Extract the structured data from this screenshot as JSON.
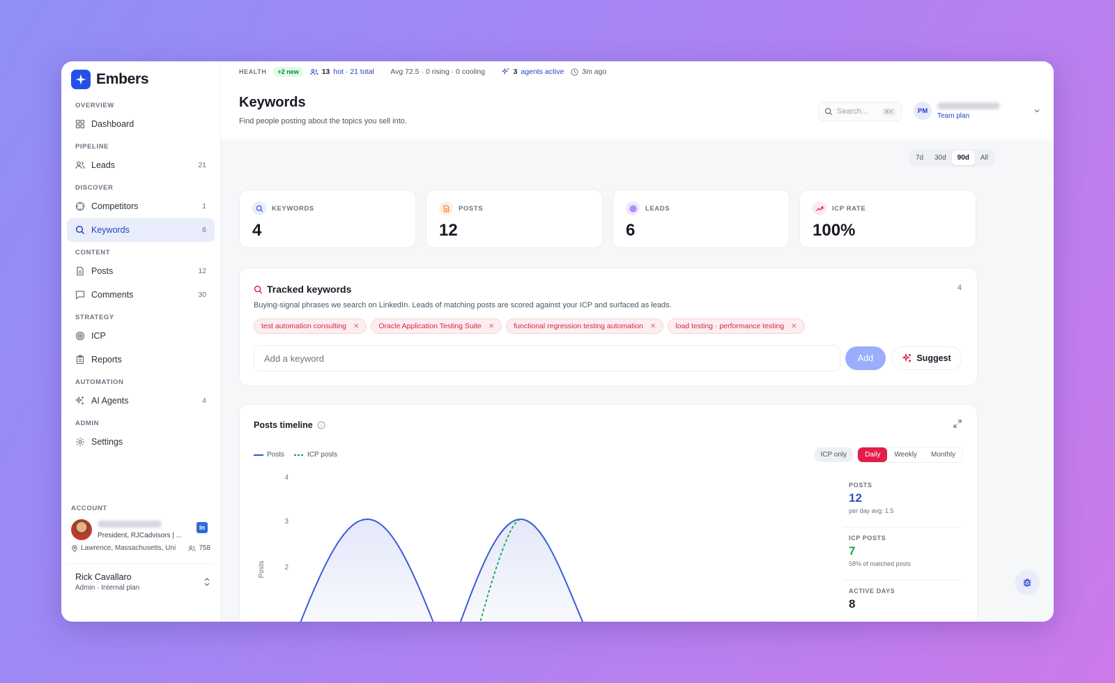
{
  "brand": {
    "name": "Embers"
  },
  "sidebar": {
    "sections": {
      "overview": "OVERVIEW",
      "pipeline": "PIPELINE",
      "discover": "DISCOVER",
      "content": "CONTENT",
      "strategy": "STRATEGY",
      "automation": "AUTOMATION",
      "admin": "ADMIN"
    },
    "items": {
      "dashboard": {
        "label": "Dashboard",
        "icon": "grid-icon"
      },
      "leads": {
        "label": "Leads",
        "count": "21",
        "icon": "users-icon"
      },
      "competitors": {
        "label": "Competitors",
        "count": "1",
        "icon": "crosshair-icon"
      },
      "keywords": {
        "label": "Keywords",
        "count": "6",
        "icon": "search-icon"
      },
      "posts": {
        "label": "Posts",
        "count": "12",
        "icon": "file-icon"
      },
      "comments": {
        "label": "Comments",
        "count": "30",
        "icon": "comment-icon"
      },
      "icp": {
        "label": "ICP",
        "icon": "target-icon"
      },
      "reports": {
        "label": "Reports",
        "icon": "clipboard-icon"
      },
      "agents": {
        "label": "AI Agents",
        "count": "4",
        "icon": "sparkles-icon"
      },
      "settings": {
        "label": "Settings",
        "icon": "gear-icon"
      }
    },
    "account": {
      "section": "ACCOUNT",
      "title": "President, RJCadvisors | ...",
      "location": "Lawrence, Massachusetts, Uni",
      "connections": "758",
      "linkedin": "in"
    },
    "user": {
      "name": "Rick Cavallaro",
      "role": "Admin · Internal plan"
    }
  },
  "topbar": {
    "health": "HEALTH",
    "new_badge": "+2 new",
    "hot_count": "13",
    "hot_text": "hot · 21 total",
    "avg": "Avg 72.5 · 0 rising · 0 cooling",
    "agents_count": "3",
    "agents_text": "agents active",
    "updated": "3m ago"
  },
  "header": {
    "title": "Keywords",
    "subtitle": "Find people posting about the topics you sell into.",
    "search_placeholder": "Search...",
    "search_kbd": "⌘K",
    "user_initials": "PM",
    "user_plan": "Team plan"
  },
  "range": {
    "options": [
      "7d",
      "30d",
      "90d",
      "All"
    ],
    "selected": "90d"
  },
  "stats": [
    {
      "label": "KEYWORDS",
      "value": "4",
      "icon": "search-icon",
      "color": "#4b5bd6",
      "bg": "#e9edfb"
    },
    {
      "label": "POSTS",
      "value": "12",
      "icon": "file-icon",
      "color": "#e8833a",
      "bg": "#fdeee2"
    },
    {
      "label": "LEADS",
      "value": "6",
      "icon": "target-icon",
      "color": "#8b5cf6",
      "bg": "#efe8fd"
    },
    {
      "label": "ICP RATE",
      "value": "100%",
      "icon": "trend-up-icon",
      "color": "#e11d48",
      "bg": "#fde8ec"
    }
  ],
  "tracked": {
    "title": "Tracked keywords",
    "count": "4",
    "description": "Buying-signal phrases we search on LinkedIn. Leads of matching posts are scored against your ICP and surfaced as leads.",
    "tags": [
      "test automation consulting",
      "Oracle Application Testing Suite",
      "functional regression testing automation",
      "load testing · performance testing"
    ],
    "input_placeholder": "Add a keyword",
    "add_label": "Add",
    "suggest_label": "Suggest"
  },
  "timeline": {
    "title": "Posts timeline",
    "legend_posts": "Posts",
    "legend_icp": "ICP posts",
    "icp_only": "ICP only",
    "modes": [
      "Daily",
      "Weekly",
      "Monthly"
    ],
    "selected_mode": "Daily",
    "side": [
      {
        "label": "POSTS",
        "value": "12",
        "sub": "per day avg: 1.5",
        "color": "#2f4fc7"
      },
      {
        "label": "ICP POSTS",
        "value": "7",
        "sub": "58% of matched posts",
        "color": "#16a34a"
      },
      {
        "label": "ACTIVE DAYS",
        "value": "8",
        "sub": "",
        "color": "#161a24"
      }
    ]
  },
  "chart_data": {
    "type": "area",
    "ylabel": "Posts",
    "yticks": [
      "4",
      "3",
      "2"
    ],
    "ylim": [
      0,
      4
    ],
    "series": [
      {
        "name": "Posts",
        "peaks": [
          3,
          3
        ]
      },
      {
        "name": "ICP posts",
        "peaks": [
          3
        ]
      }
    ],
    "grid": false
  }
}
